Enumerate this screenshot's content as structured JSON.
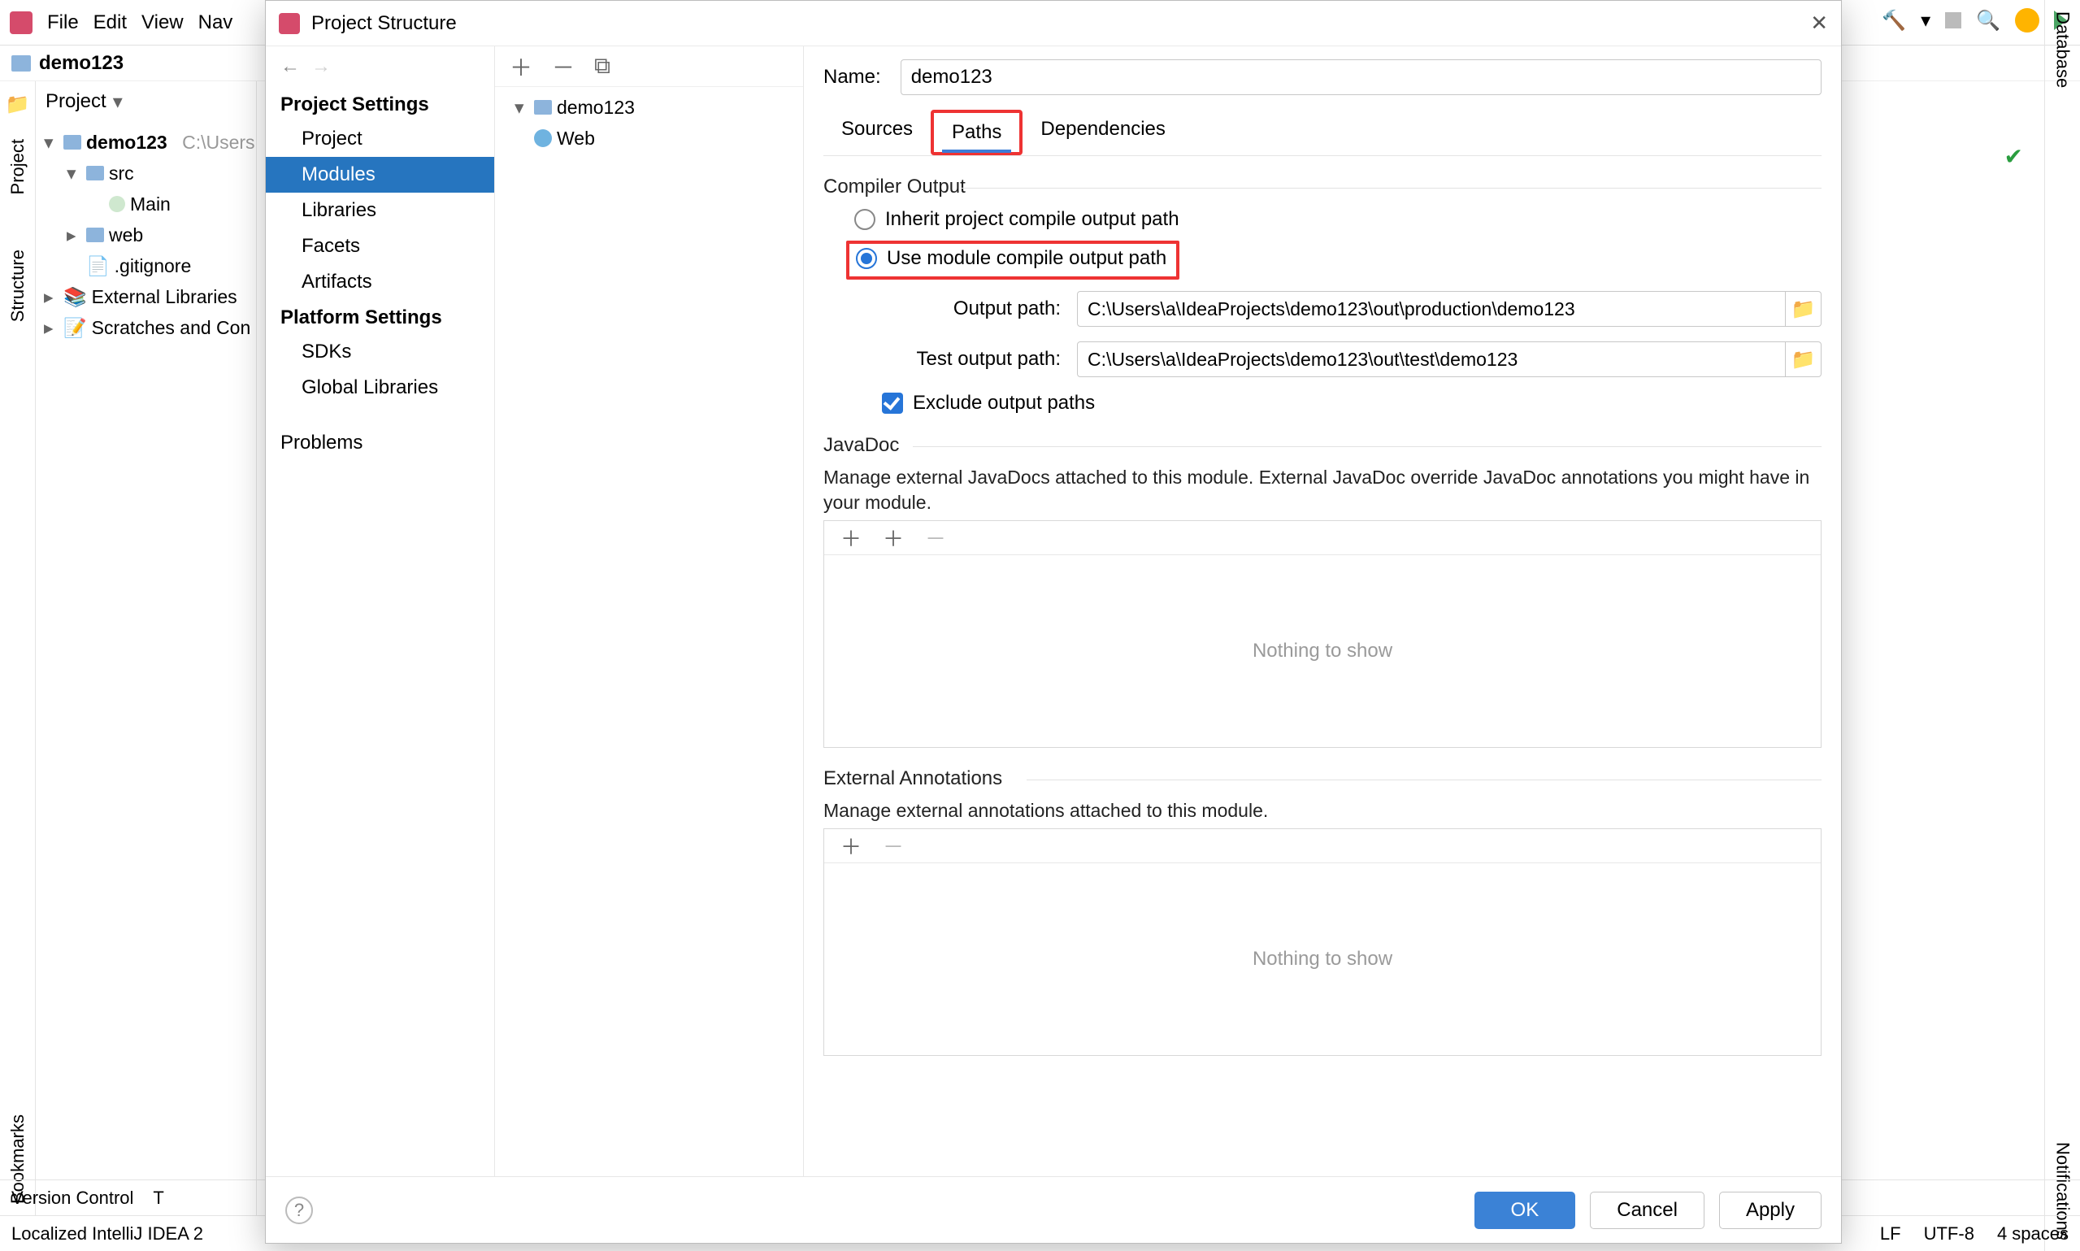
{
  "menubar": {
    "file": "File",
    "edit": "Edit",
    "view": "View",
    "nav": "Nav"
  },
  "breadcrumb": {
    "project": "demo123"
  },
  "left_tool": {
    "project": "Project",
    "structure": "Structure",
    "bookmarks": "Bookmarks"
  },
  "right_tool": {
    "database": "Database",
    "notifications": "Notifications"
  },
  "project_panel": {
    "title": "Project",
    "root": "demo123",
    "root_hint": "C:\\Users",
    "src": "src",
    "main": "Main",
    "web": "web",
    "gitignore": ".gitignore",
    "ext": "External Libraries",
    "scratch": "Scratches and Con"
  },
  "status1": {
    "vc": "Version Control",
    "todo": "T"
  },
  "status2": {
    "msg": "Localized IntelliJ IDEA 2",
    "lf": "LF",
    "enc": "UTF-8",
    "indent": "4 spaces"
  },
  "dialog": {
    "title": "Project Structure",
    "nav": {
      "settings_header": "Project Settings",
      "project": "Project",
      "modules": "Modules",
      "libraries": "Libraries",
      "facets": "Facets",
      "artifacts": "Artifacts",
      "platform_header": "Platform Settings",
      "sdks": "SDKs",
      "global_libs": "Global Libraries",
      "problems": "Problems"
    },
    "modtree": {
      "root": "demo123",
      "web": "Web"
    },
    "form": {
      "name_label": "Name:",
      "name_value": "demo123",
      "tabs": {
        "sources": "Sources",
        "paths": "Paths",
        "deps": "Dependencies"
      },
      "compiler_legend": "Compiler Output",
      "radio_inherit": "Inherit project compile output path",
      "radio_module": "Use module compile output path",
      "output_label": "Output path:",
      "output_value": "C:\\Users\\a\\IdeaProjects\\demo123\\out\\production\\demo123",
      "test_output_label": "Test output path:",
      "test_output_value": "C:\\Users\\a\\IdeaProjects\\demo123\\out\\test\\demo123",
      "exclude": "Exclude output paths",
      "javadoc_legend": "JavaDoc",
      "javadoc_desc": "Manage external JavaDocs attached to this module. External JavaDoc override JavaDoc annotations you might have in your module.",
      "annotations_legend": "External Annotations",
      "annotations_desc": "Manage external annotations attached to this module.",
      "nothing": "Nothing to show"
    },
    "buttons": {
      "ok": "OK",
      "cancel": "Cancel",
      "apply": "Apply"
    }
  }
}
